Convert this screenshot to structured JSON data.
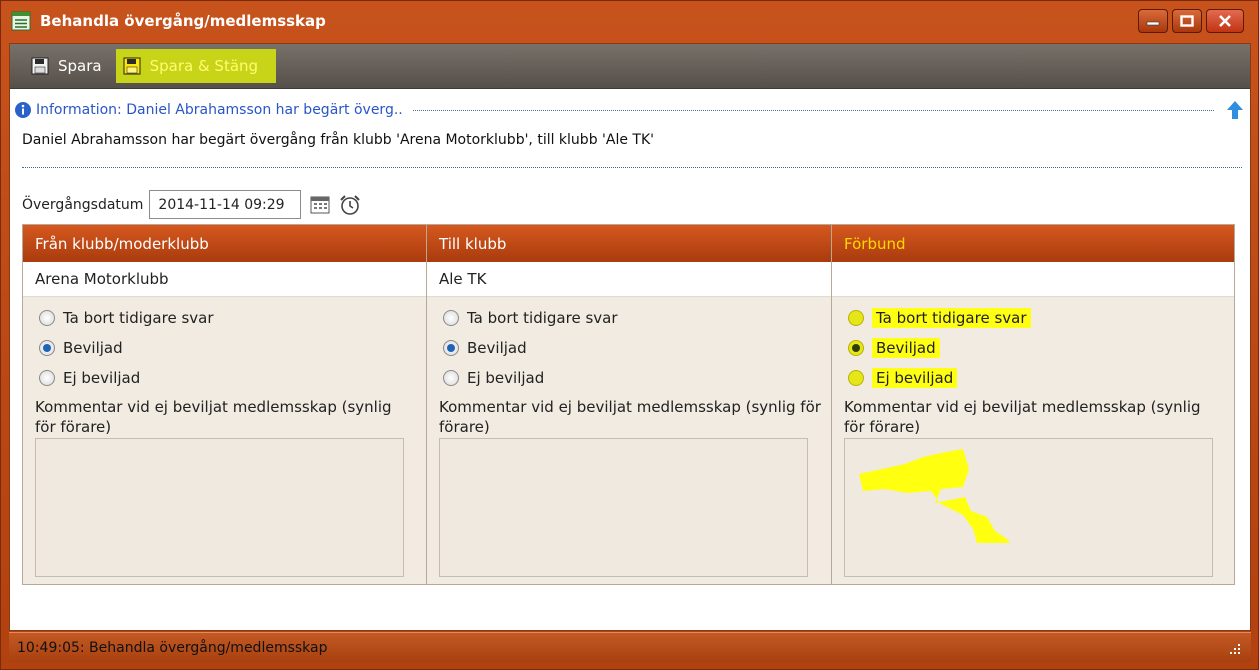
{
  "window": {
    "title": "Behandla övergång/medlemsskap",
    "icons": {
      "app": "form-icon",
      "minimize": "minimize-icon",
      "maximize": "maximize-icon",
      "close": "close-icon"
    }
  },
  "toolbar": {
    "save_label": "Spara",
    "save_close_label": "Spara & Stäng",
    "highlight_color": "#c8d417"
  },
  "info": {
    "header": "Information: Daniel Abrahamsson har begärt överg..",
    "text": "Daniel Abrahamsson har begärt övergång från klubb 'Arena Motorklubb', till klubb 'Ale TK'"
  },
  "date": {
    "label": "Övergångsdatum",
    "value": "2014-11-14 09:29"
  },
  "columns": [
    {
      "header": "Från klubb/moderklubb",
      "value": "Arena Motorklubb",
      "options": [
        "Ta bort tidigare svar",
        "Beviljad",
        "Ej beviljad"
      ],
      "selected": 1,
      "comment_label": "Kommentar vid ej beviljat medlemsskap (synlig för förare)"
    },
    {
      "header": "Till klubb",
      "value": "Ale TK",
      "options": [
        "Ta bort tidigare svar",
        "Beviljad",
        "Ej beviljad"
      ],
      "selected": 1,
      "comment_label": "Kommentar vid ej beviljat medlemsskap (synlig för förare)"
    },
    {
      "header": "Förbund",
      "value": "",
      "options": [
        "Ta bort tidigare svar",
        "Beviljad",
        "Ej beviljad"
      ],
      "selected": 1,
      "comment_label": "Kommentar vid ej beviljat medlemsskap (synlig för förare)"
    }
  ],
  "status": {
    "text": "10:49:05: Behandla övergång/medlemsskap"
  },
  "colors": {
    "accent": "#c7521c",
    "info_text": "#2a55c9",
    "highlight": "#ffff14"
  }
}
